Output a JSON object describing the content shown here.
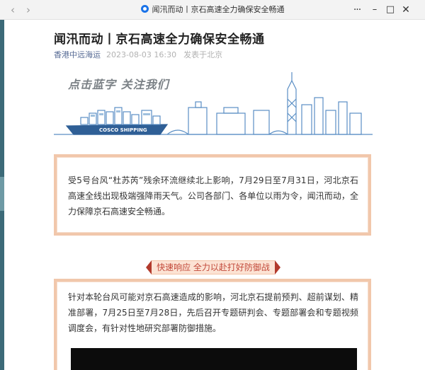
{
  "window": {
    "title": "闻汛而动丨京石高速全力确保安全畅通",
    "back_glyph": "‹",
    "forward_glyph": "›",
    "more_glyph": "···",
    "minimize_glyph": "–",
    "maximize_glyph": "□",
    "close_glyph": "✕",
    "icon": "wechat-icon"
  },
  "article": {
    "title": "闻汛而动丨京石高速全力确保安全畅通",
    "account": "香港中远海运",
    "date": "2023-08-03 16:30",
    "location": "发表于北京",
    "banner": {
      "slogan": "点击蓝字 关注我们",
      "ship_label": "COSCO SHIPPING"
    },
    "intro": "受5号台风“杜苏芮”残余环流继续北上影响，7月29日至7月31日，河北京石高速全线出现极端强降雨天气。公司各部门、各单位以雨为令，闻汛而动，全力保障京石高速安全畅通。",
    "section_heading": "快速响应 全力以赴打好防御战",
    "section_text": "针对本轮台风可能对京石高速造成的影响，河北京石提前预判、超前谋划、精准部署，7月25日至7月28日，先后召开专题研判会、专题部署会和专题视频调度会，有针对性地研究部署防御措施。"
  },
  "colors": {
    "accent_link": "#576b95",
    "frame_border": "#f1c7ab",
    "ribbon_bg": "#fce3d4",
    "ribbon_text": "#c2493a",
    "ribbon_tips": "#b23a2c",
    "banner_line": "#5a8ec4"
  }
}
